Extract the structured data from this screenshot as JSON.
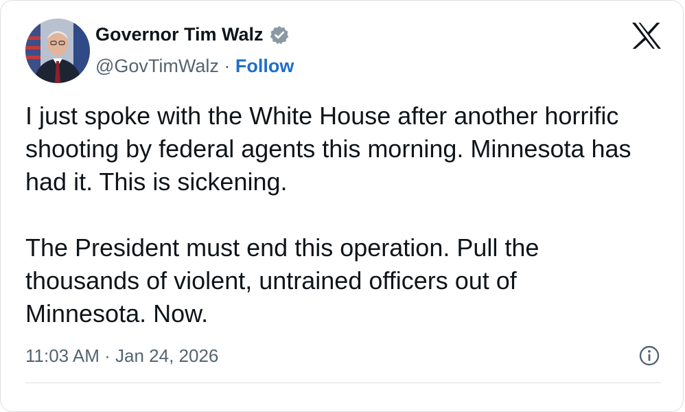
{
  "tweet": {
    "author": {
      "display_name": "Governor Tim Walz",
      "handle": "@GovTimWalz",
      "verified": true,
      "avatar_icon": "profile-photo"
    },
    "separator": " · ",
    "follow_label": "Follow",
    "paragraphs": [
      "I just spoke with the White House after another horrific shooting by federal agents this morning. Minnesota has had it. This is sickening.",
      "The President must end this operation. Pull the thousands of violent, untrained officers out of Minnesota. Now."
    ],
    "timestamp": "11:03 AM · Jan 24, 2026",
    "icons": {
      "brand": "x-logo-icon",
      "verified": "verified-badge-icon",
      "info": "info-icon"
    },
    "colors": {
      "text": "#0f1419",
      "secondary": "#536471",
      "follow": "#1d6fc9",
      "badge": "#8b98a5",
      "border": "#dcdfe3"
    }
  }
}
